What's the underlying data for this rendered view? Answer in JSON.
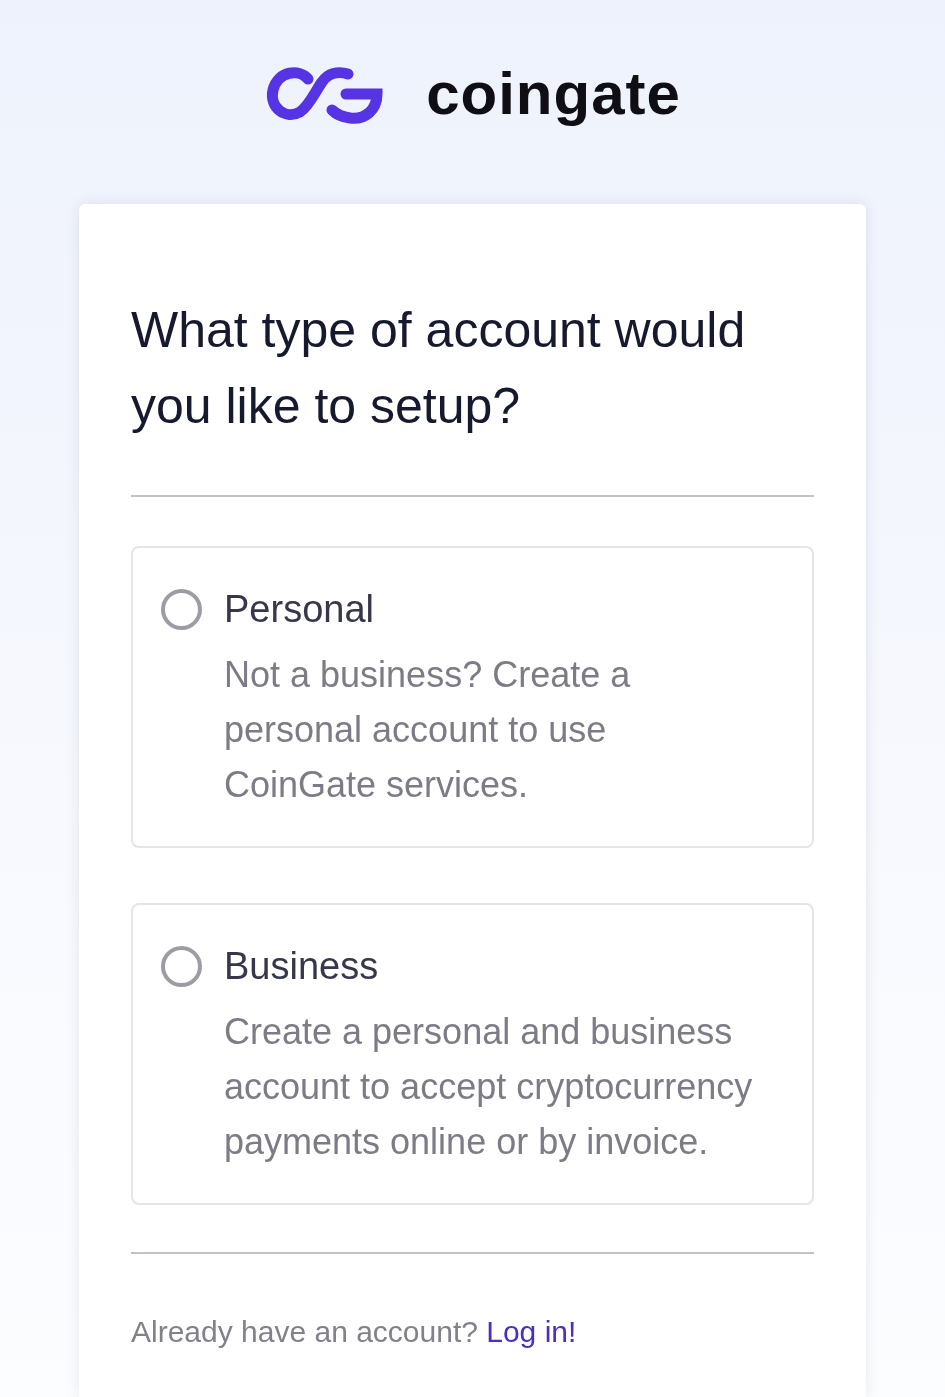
{
  "logo": {
    "wordmark": "coingate"
  },
  "heading": "What type of account would you like to setup?",
  "options": [
    {
      "title": "Personal",
      "description": "Not a business? Create a personal account to use CoinGate services.",
      "selected": false
    },
    {
      "title": "Business",
      "description": "Create a personal and business account to accept cryptocurrency payments online or by invoice.",
      "selected": false
    }
  ],
  "footer": {
    "text": "Already have an account?",
    "link": "Log in!"
  }
}
